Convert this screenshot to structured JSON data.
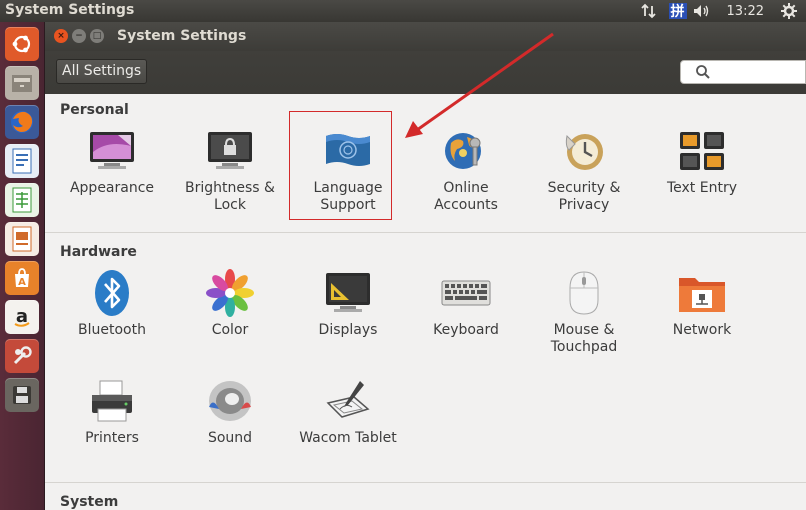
{
  "top_panel": {
    "title": "System Settings",
    "clock": "13:22",
    "ime": "拼",
    "tray_icons": [
      "network-arrows-icon",
      "keyboard-ime-icon",
      "volume-icon",
      "gear-icon"
    ]
  },
  "launcher": {
    "items": [
      "ubuntu-dash",
      "files",
      "firefox",
      "libreoffice-writer",
      "libreoffice-calc",
      "libreoffice-impress",
      "software-center",
      "amazon",
      "system-settings",
      "floppy-save"
    ]
  },
  "window": {
    "title": "System Settings",
    "all_settings_label": "All Settings",
    "search_placeholder": ""
  },
  "sections": {
    "personal": {
      "title": "Personal",
      "items": [
        {
          "label": "Appearance"
        },
        {
          "label": "Brightness &\nLock"
        },
        {
          "label": "Language\nSupport"
        },
        {
          "label": "Online\nAccounts"
        },
        {
          "label": "Security &\nPrivacy"
        },
        {
          "label": "Text Entry"
        }
      ]
    },
    "hardware": {
      "title": "Hardware",
      "items": [
        {
          "label": "Bluetooth"
        },
        {
          "label": "Color"
        },
        {
          "label": "Displays"
        },
        {
          "label": "Keyboard"
        },
        {
          "label": "Mouse &\nTouchpad"
        },
        {
          "label": "Network"
        },
        {
          "label": "Printers"
        },
        {
          "label": "Sound"
        },
        {
          "label": "Wacom Tablet"
        }
      ]
    },
    "system": {
      "title": "System"
    }
  },
  "colors": {
    "highlight": "#d32a2a",
    "launcher_bg": "#4a2532",
    "panel_bg": "#3c3b37"
  }
}
